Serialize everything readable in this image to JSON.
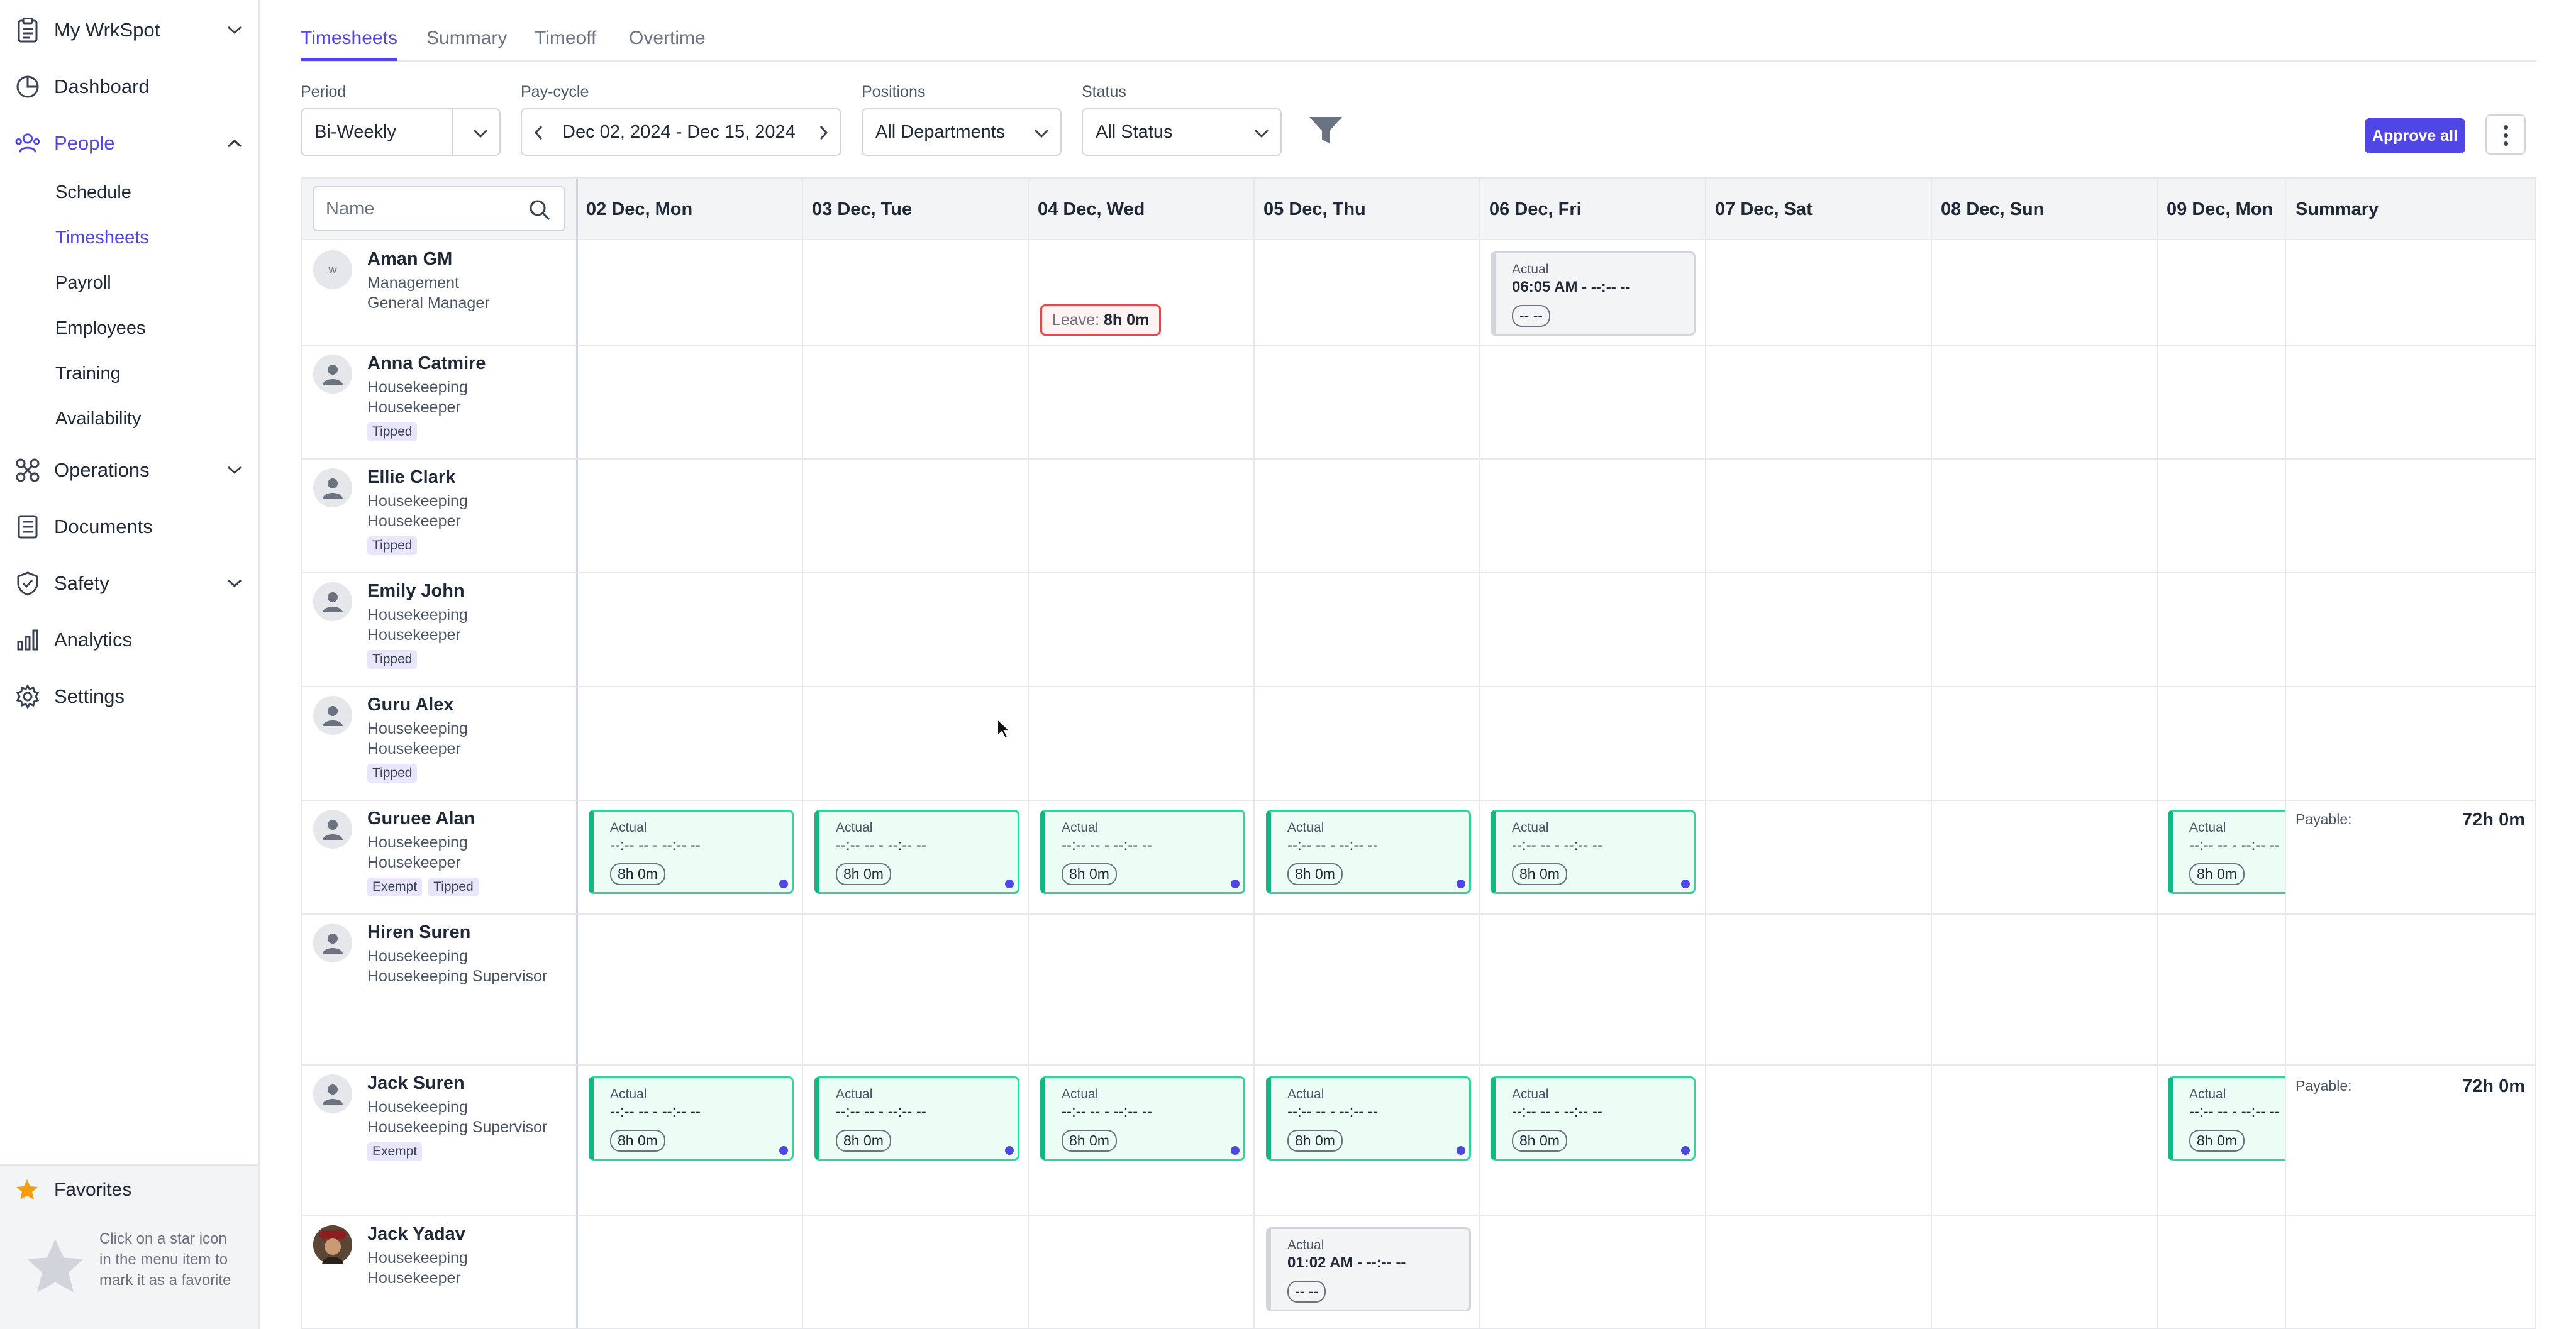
{
  "colors": {
    "accent": "#4f46e5",
    "shift_border": "#10b981",
    "shift_bg": "#ecfdf5",
    "leave_border": "#ef4444",
    "badge_bg": "#e9e6fb"
  },
  "sidebar": {
    "workspace": "My WrkSpot",
    "items": [
      {
        "label": "Dashboard",
        "icon": "dashboard-icon"
      },
      {
        "label": "People",
        "icon": "people-icon"
      },
      {
        "label": "Operations",
        "icon": "operations-icon"
      },
      {
        "label": "Documents",
        "icon": "documents-icon"
      },
      {
        "label": "Safety",
        "icon": "shield-icon"
      },
      {
        "label": "Analytics",
        "icon": "analytics-icon"
      },
      {
        "label": "Settings",
        "icon": "gear-icon"
      }
    ],
    "people_sub": [
      "Schedule",
      "Timesheets",
      "Payroll",
      "Employees",
      "Training",
      "Availability"
    ],
    "favorites": {
      "label": "Favorites",
      "hint": "Click on a star icon in the menu item to mark it as a favorite"
    }
  },
  "tabs": [
    "Timesheets",
    "Summary",
    "Timeoff",
    "Overtime"
  ],
  "filters": {
    "period": {
      "label": "Period",
      "value": "Bi-Weekly"
    },
    "paycycle": {
      "label": "Pay-cycle",
      "value": "Dec 02, 2024 - Dec 15, 2024"
    },
    "positions": {
      "label": "Positions",
      "value": "All Departments"
    },
    "status": {
      "label": "Status",
      "value": "All Status"
    }
  },
  "actions": {
    "approve_all": "Approve all"
  },
  "grid": {
    "search_placeholder": "Name",
    "days": [
      "02 Dec, Mon",
      "03 Dec, Tue",
      "04 Dec, Wed",
      "05 Dec, Thu",
      "06 Dec, Fri",
      "07 Dec, Sat",
      "08 Dec, Sun",
      "09 Dec, Mon"
    ],
    "summary_header": "Summary"
  },
  "employees": [
    {
      "name": "Aman GM",
      "dept": "Management",
      "position": "General Manager",
      "badges": [],
      "avatar_initial": "w"
    },
    {
      "name": "Anna Catmire",
      "dept": "Housekeeping",
      "position": "Housekeeper",
      "badges": [
        "Tipped"
      ]
    },
    {
      "name": "Ellie Clark",
      "dept": "Housekeeping",
      "position": "Housekeeper",
      "badges": [
        "Tipped"
      ]
    },
    {
      "name": "Emily John",
      "dept": "Housekeeping",
      "position": "Housekeeper",
      "badges": [
        "Tipped"
      ]
    },
    {
      "name": "Guru Alex",
      "dept": "Housekeeping",
      "position": "Housekeeper",
      "badges": [
        "Tipped"
      ]
    },
    {
      "name": "Guruee Alan",
      "dept": "Housekeeping",
      "position": "Housekeeper",
      "badges": [
        "Exempt",
        "Tipped"
      ]
    },
    {
      "name": "Hiren Suren",
      "dept": "Housekeeping",
      "position": "Housekeeping Supervisor",
      "badges": []
    },
    {
      "name": "Jack Suren",
      "dept": "Housekeeping",
      "position": "Housekeeping Supervisor",
      "badges": [
        "Exempt"
      ]
    },
    {
      "name": "Jack Yadav",
      "dept": "Housekeeping",
      "position": "Housekeeper",
      "badges": []
    }
  ],
  "shift": {
    "actual_label": "Actual",
    "empty_time": "--:-- -- - --:-- --",
    "duration": "8h 0m",
    "empty_duration": "-- --"
  },
  "aman_fri": {
    "time": "06:05 AM - --:-- --"
  },
  "jack_yadav_thu": {
    "time": "01:02 AM - --:-- --"
  },
  "leave": {
    "label": "Leave:",
    "value": "8h 0m"
  },
  "summary": {
    "payable_label": "Payable:",
    "guruee_alan": "72h 0m",
    "jack_suren": "72h 0m"
  }
}
